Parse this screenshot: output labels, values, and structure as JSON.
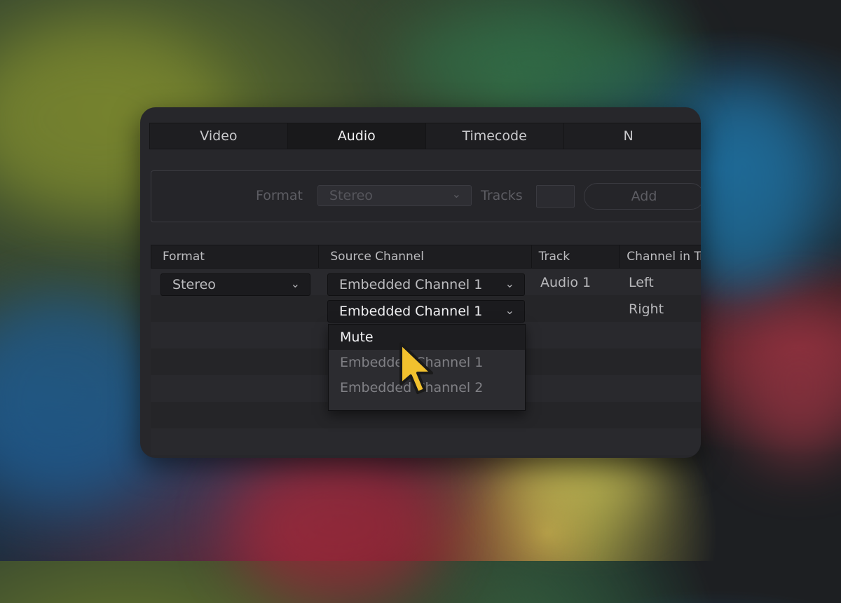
{
  "tabs": [
    {
      "label": "Video",
      "active": false
    },
    {
      "label": "Audio",
      "active": true
    },
    {
      "label": "Timecode",
      "active": false
    },
    {
      "label": "N",
      "active": false
    }
  ],
  "toolbar": {
    "format_label": "Format",
    "format_value": "Stereo",
    "tracks_label": "Tracks",
    "tracks_value": "",
    "add_label": "Add"
  },
  "table": {
    "columns": [
      "Format",
      "Source Channel",
      "Track",
      "Channel in Tr"
    ],
    "row": {
      "format": "Stereo",
      "source_channel_left": "Embedded Channel 1",
      "source_channel_right": "Embedded Channel 1",
      "track": "Audio 1",
      "channel_left": "Left",
      "channel_right": "Right"
    }
  },
  "dropdown": {
    "options": [
      "Mute",
      "Embedded Channel 1",
      "Embedded Channel 2"
    ],
    "hovered": "Mute"
  },
  "colors": {
    "cursor_fill": "#f2c12e",
    "panel_bg": "#27272b"
  },
  "icons": {
    "chevron": "chevron-down-icon",
    "cursor": "pointer-cursor-icon"
  }
}
